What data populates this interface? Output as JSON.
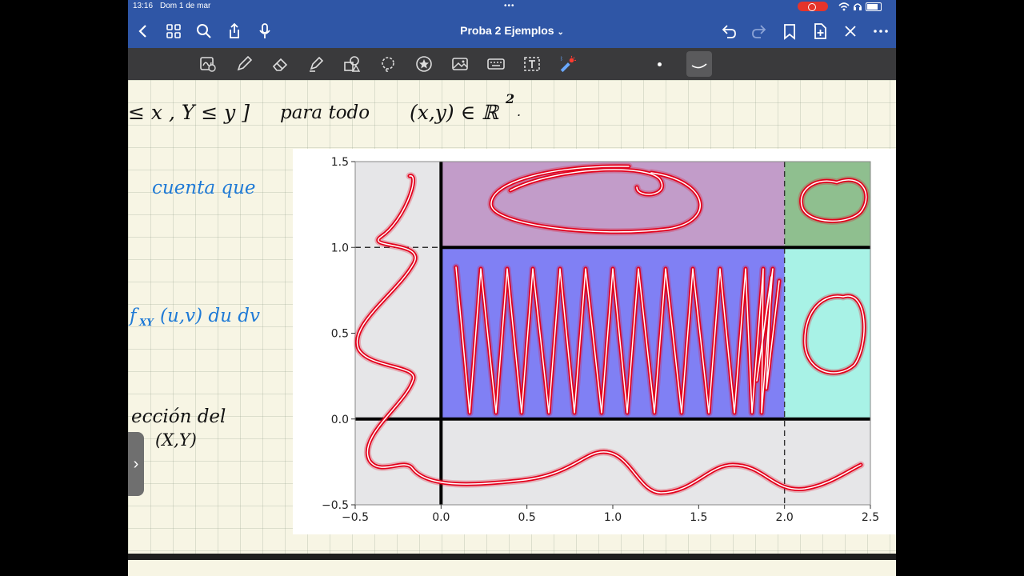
{
  "status_bar": {
    "time": "13:16",
    "date": "Dom 1 de mar",
    "battery_icon": "battery-icon",
    "wifi_icon": "wifi-icon",
    "headphones_icon": "headphones-icon",
    "screen_record_icon": "screen-record-icon"
  },
  "nav_bar": {
    "title": "Proba 2 Ejemplos",
    "title_chevron": "⌄",
    "left_icons": [
      "back-icon",
      "grid-icon",
      "search-icon",
      "share-icon",
      "microphone-icon"
    ],
    "right_icons": [
      "undo-icon",
      "redo-icon",
      "bookmark-icon",
      "add-page-icon",
      "close-icon",
      "more-icon"
    ]
  },
  "tools": {
    "icons": [
      "read-only-icon",
      "pen-icon",
      "eraser-icon",
      "highlighter-icon",
      "shapes-icon",
      "lasso-icon",
      "sticker-icon",
      "image-icon",
      "keyboard-icon",
      "text-icon",
      "laser-pointer-icon"
    ],
    "selected_stroke": "dot-stroke-icon",
    "selected_curve": "curve-stroke-icon"
  },
  "notes": {
    "line1_a": "≤ x , Y ≤ y ]",
    "line1_b": "para  todo",
    "line1_c": "(x,y) ∈ ℝ",
    "line1_sup": "2",
    "line1_dot": ".",
    "blue1": "cuenta  que",
    "blue2_f": "f",
    "blue2_sub": "XY",
    "blue2_rest": "(u,v) du dv",
    "black3": "ección  del",
    "black4": "(X,Y)"
  },
  "chart_data": {
    "type": "scatter",
    "title": "",
    "xlabel": "",
    "ylabel": "",
    "xlim": [
      -0.5,
      2.5
    ],
    "ylim": [
      -0.5,
      1.5
    ],
    "xticks": [
      "−0.5",
      "0.0",
      "0.5",
      "1.0",
      "1.5",
      "2.0",
      "2.5"
    ],
    "yticks": [
      "−0.5",
      "0.0",
      "0.5",
      "1.0",
      "1.5"
    ],
    "regions": [
      {
        "name": "gray_background",
        "x": [
          -0.5,
          2.5
        ],
        "y": [
          -0.5,
          1.5
        ],
        "color": "#e6e6e8"
      },
      {
        "name": "purple",
        "x": [
          0,
          2
        ],
        "y": [
          1,
          1.5
        ],
        "color": "#c29cc9"
      },
      {
        "name": "blue",
        "x": [
          0,
          2
        ],
        "y": [
          0,
          1
        ],
        "color": "#8080f4"
      },
      {
        "name": "green",
        "x": [
          2,
          2.5
        ],
        "y": [
          1,
          1.5
        ],
        "color": "#8fbf8f"
      },
      {
        "name": "cyan",
        "x": [
          2,
          2.5
        ],
        "y": [
          0,
          1
        ],
        "color": "#a8f2e6"
      }
    ],
    "lines": [
      {
        "orientation": "vertical",
        "value": 0,
        "style": "solid",
        "color": "#000000"
      },
      {
        "orientation": "horizontal",
        "value": 0,
        "style": "solid",
        "color": "#000000"
      },
      {
        "orientation": "vertical",
        "value": 2,
        "style": "dashed",
        "color": "#333333"
      },
      {
        "orientation": "horizontal",
        "value": 1,
        "style": "dashed",
        "color": "#333333",
        "x": [
          -0.5,
          0
        ]
      },
      {
        "orientation": "horizontal",
        "value": 1,
        "style": "solid",
        "color": "#000000",
        "x": [
          0,
          2.5
        ]
      }
    ],
    "annotation_color": "#e3001b"
  },
  "sidebar_handle": {
    "label": "›"
  }
}
